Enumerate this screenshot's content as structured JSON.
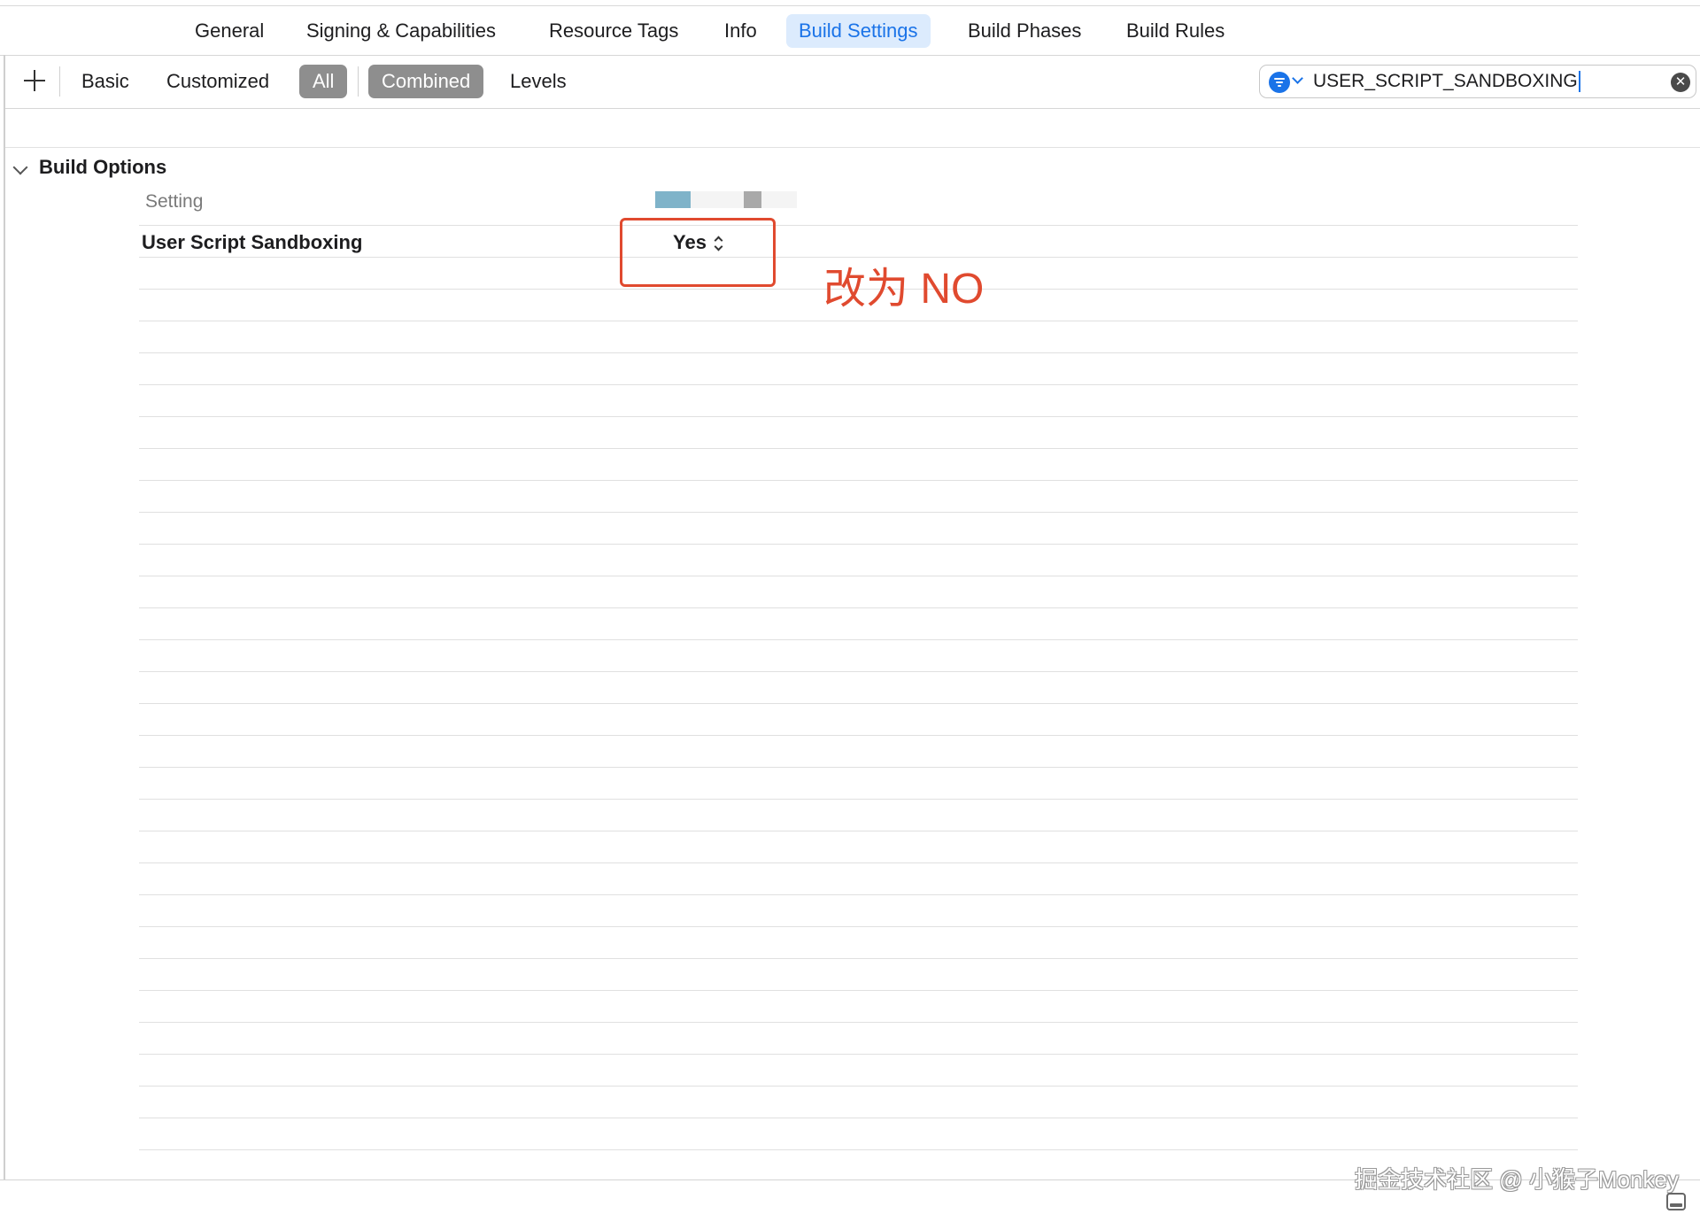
{
  "tabs": [
    {
      "label": "General",
      "active": false
    },
    {
      "label": "Signing & Capabilities",
      "active": false
    },
    {
      "label": "Resource Tags",
      "active": false
    },
    {
      "label": "Info",
      "active": false
    },
    {
      "label": "Build Settings",
      "active": true
    },
    {
      "label": "Build Phases",
      "active": false
    },
    {
      "label": "Build Rules",
      "active": false
    }
  ],
  "toolbar": {
    "add_icon": "plus-icon",
    "basic_label": "Basic",
    "customized_label": "Customized",
    "all_label": "All",
    "combined_label": "Combined",
    "levels_label": "Levels"
  },
  "search": {
    "filter_icon": "filter-icon",
    "value": "USER_SCRIPT_SANDBOXING",
    "clear_icon": "clear-icon"
  },
  "section": {
    "title": "Build Options",
    "column_header": "Setting",
    "setting": {
      "name": "User Script Sandboxing",
      "value": "Yes"
    }
  },
  "annotation": {
    "text": "改为 NO",
    "color": "#e04a2f"
  },
  "watermark": "掘金技术社区 @ 小猴子Monkey",
  "colors": {
    "accent": "#1a73e8",
    "active_tab_bg": "#dcebfd",
    "pill_bg": "#8e8e8e"
  }
}
